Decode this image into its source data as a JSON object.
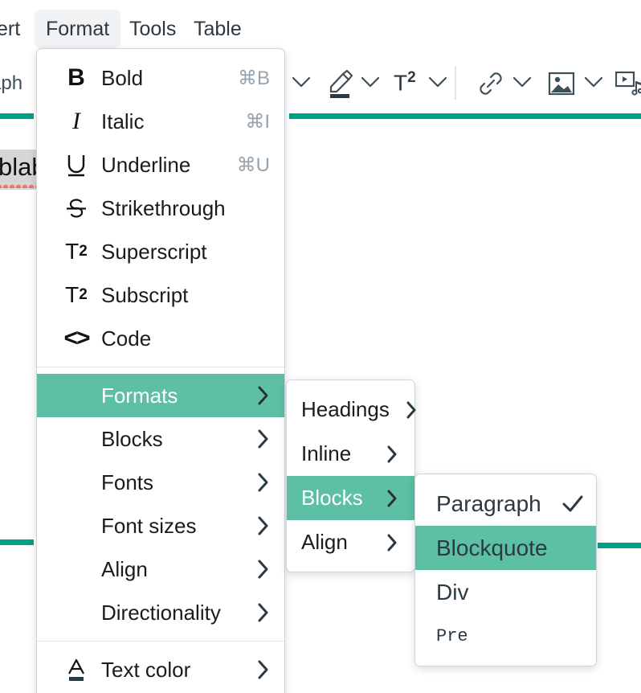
{
  "app": {
    "type": "rich-text-editor",
    "colors": {
      "menu_highlight": "#5dbfa3",
      "rule_green": "#00a187",
      "menubar_active_bg": "#f1f2f3",
      "text_dark": "#2b3a42",
      "shortcut_gray": "#97a4ae",
      "spellcheck_red": "#f2736b"
    }
  },
  "menubar": {
    "items": [
      {
        "label": "ert",
        "active": false
      },
      {
        "label": "Format",
        "active": true
      },
      {
        "label": "Tools",
        "active": false
      },
      {
        "label": "Table",
        "active": false
      }
    ]
  },
  "toolbar": {
    "block_format_value": "raph",
    "icons": [
      {
        "name": "chevron-down-icon",
        "label": ""
      },
      {
        "name": "highlight-pen-icon",
        "label": ""
      },
      {
        "name": "chevron-down-icon",
        "label": ""
      },
      {
        "name": "superscript-icon",
        "label": "T2"
      },
      {
        "name": "chevron-down-icon",
        "label": ""
      },
      {
        "name": "link-icon",
        "label": ""
      },
      {
        "name": "chevron-down-icon",
        "label": ""
      },
      {
        "name": "image-icon",
        "label": ""
      },
      {
        "name": "chevron-down-icon",
        "label": ""
      },
      {
        "name": "media-icon",
        "label": ""
      }
    ]
  },
  "document": {
    "selected_text": "blab",
    "spellcheck_underline": true
  },
  "menus": {
    "format": {
      "title": "Format",
      "groups": [
        {
          "items": [
            {
              "icon": "bold-icon",
              "icon_glyph": "B",
              "label": "Bold",
              "shortcut": "⌘B",
              "selected": false,
              "submenu": false
            },
            {
              "icon": "italic-icon",
              "icon_glyph": "I",
              "label": "Italic",
              "shortcut": "⌘I",
              "selected": false,
              "submenu": false
            },
            {
              "icon": "underline-icon",
              "icon_glyph": "U",
              "label": "Underline",
              "shortcut": "⌘U",
              "selected": false,
              "submenu": false
            },
            {
              "icon": "strikethrough-icon",
              "icon_glyph": "S",
              "label": "Strikethrough",
              "shortcut": "",
              "selected": false,
              "submenu": false
            },
            {
              "icon": "superscript-icon",
              "icon_glyph": "T2",
              "label": "Superscript",
              "shortcut": "",
              "selected": false,
              "submenu": false
            },
            {
              "icon": "subscript-icon",
              "icon_glyph": "T2",
              "label": "Subscript",
              "shortcut": "",
              "selected": false,
              "submenu": false
            },
            {
              "icon": "code-icon",
              "icon_glyph": "<>",
              "label": "Code",
              "shortcut": "",
              "selected": false,
              "submenu": false
            }
          ]
        },
        {
          "items": [
            {
              "icon": "",
              "label": "Formats",
              "shortcut": "",
              "selected": true,
              "submenu": true
            },
            {
              "icon": "",
              "label": "Blocks",
              "shortcut": "",
              "selected": false,
              "submenu": true
            },
            {
              "icon": "",
              "label": "Fonts",
              "shortcut": "",
              "selected": false,
              "submenu": true
            },
            {
              "icon": "",
              "label": "Font sizes",
              "shortcut": "",
              "selected": false,
              "submenu": true
            },
            {
              "icon": "",
              "label": "Align",
              "shortcut": "",
              "selected": false,
              "submenu": true
            },
            {
              "icon": "",
              "label": "Directionality",
              "shortcut": "",
              "selected": false,
              "submenu": true
            }
          ]
        },
        {
          "items": [
            {
              "icon": "text-color-icon",
              "icon_glyph": "A",
              "label": "Text color",
              "shortcut": "",
              "selected": false,
              "submenu": true
            }
          ]
        }
      ]
    },
    "formats": {
      "title": "Formats",
      "items": [
        {
          "label": "Headings",
          "selected": false,
          "submenu": true
        },
        {
          "label": "Inline",
          "selected": false,
          "submenu": true
        },
        {
          "label": "Blocks",
          "selected": true,
          "submenu": true
        },
        {
          "label": "Align",
          "selected": false,
          "submenu": true
        }
      ]
    },
    "blocks": {
      "title": "Blocks",
      "items": [
        {
          "label": "Paragraph",
          "selected": false,
          "checked": true,
          "mono": false
        },
        {
          "label": "Blockquote",
          "selected": true,
          "checked": false,
          "mono": false
        },
        {
          "label": "Div",
          "selected": false,
          "checked": false,
          "mono": false
        },
        {
          "label": "Pre",
          "selected": false,
          "checked": false,
          "mono": true
        }
      ]
    }
  }
}
